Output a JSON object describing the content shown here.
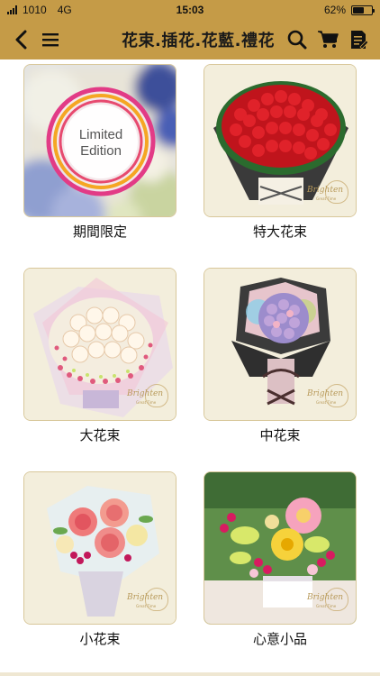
{
  "status_bar": {
    "carrier": "1010",
    "network": "4G",
    "time": "15:03",
    "battery_percent": "62%",
    "battery_level": 0.62
  },
  "nav": {
    "title": "花束.插花.花藍.禮花",
    "icons": [
      "back-icon",
      "menu-icon",
      "search-icon",
      "cart-icon",
      "order-list-icon"
    ],
    "background_color": "#c59b47"
  },
  "categories": [
    {
      "label": "期間限定",
      "badge_line1": "Limited",
      "badge_line2": "Edition"
    },
    {
      "label": "特大花束"
    },
    {
      "label": "大花束"
    },
    {
      "label": "中花束"
    },
    {
      "label": "小花束"
    },
    {
      "label": "心意小品"
    }
  ],
  "brand": {
    "script": "Brighten",
    "tagline": "Great Time"
  }
}
